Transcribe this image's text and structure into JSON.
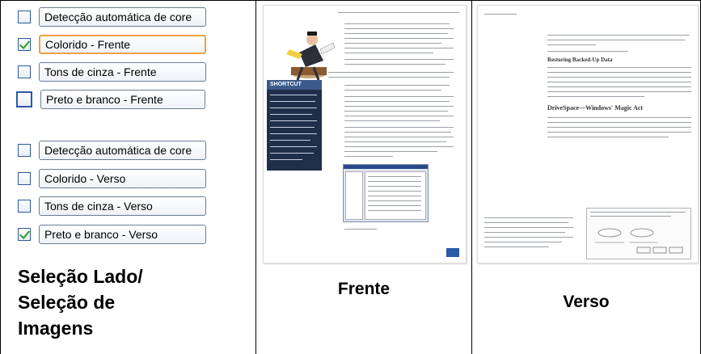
{
  "left_panel": {
    "options_front": [
      {
        "label": "Detecção automática de core",
        "checked": false
      },
      {
        "label": "Colorido - Frente",
        "checked": true
      },
      {
        "label": "Tons de cinza - Frente",
        "checked": false
      },
      {
        "label": "Preto e branco - Frente",
        "checked": false
      }
    ],
    "options_back": [
      {
        "label": "Detecção automática de core",
        "checked": false
      },
      {
        "label": "Colorido - Verso",
        "checked": false
      },
      {
        "label": "Tons de cinza - Verso",
        "checked": false
      },
      {
        "label": "Preto e branco - Verso",
        "checked": true
      }
    ],
    "caption_lines": [
      "Seleção Lado/",
      "Seleção de",
      "Imagens"
    ]
  },
  "front_panel": {
    "caption": "Frente",
    "sidebar_title": "SHORTCUT"
  },
  "back_panel": {
    "caption": "Verso",
    "heading_1": "Restoring Backed-Up Data",
    "heading_2": "DriveSpace—Windows' Magic Act"
  }
}
